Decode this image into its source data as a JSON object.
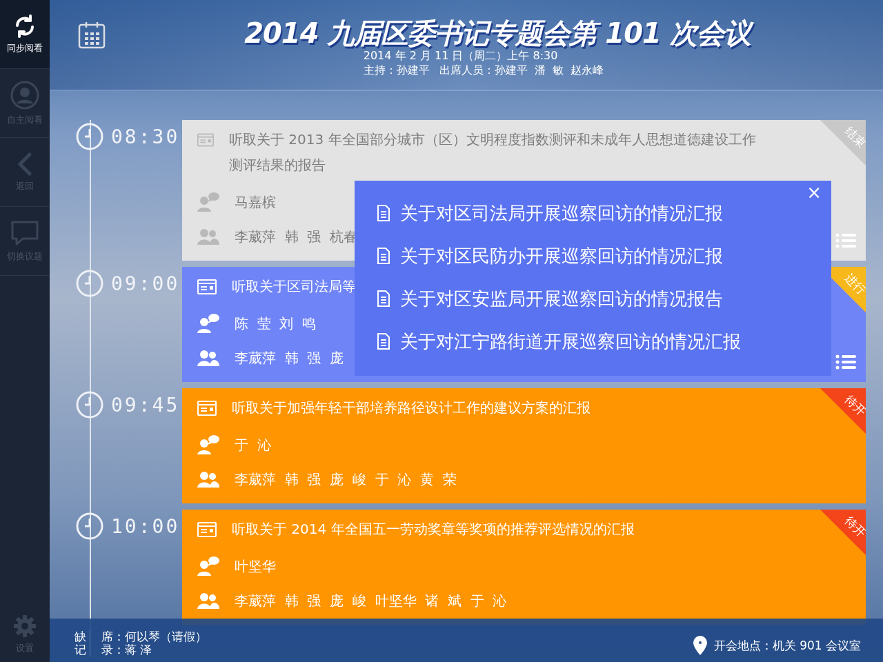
{
  "sidebar": {
    "items": [
      {
        "label": "同步阅看",
        "selected": true
      },
      {
        "label": "自主阅看",
        "selected": false
      },
      {
        "label": "返回",
        "selected": false
      },
      {
        "label": "切换议题",
        "selected": false
      }
    ],
    "settings_label": "设置"
  },
  "header": {
    "title": "2014 九届区委书记专题会第 101 次会议",
    "date": "2014 年 2 月 11 日（周二）上午 8:30",
    "host": "主持：孙建平",
    "attendees": "出席人员：孙建平  潘  敏  赵永峰"
  },
  "agenda": [
    {
      "time": "08:30",
      "kind": "done",
      "status_label": "结束",
      "title": "听取关于 2013 年全国部分城市（区）文明程度指数测评和未成年人思想道德建设工作测评结果的报告",
      "speaker": "马嘉槟",
      "attendees": "李葳萍  韩  强  杭春",
      "has_topics": true
    },
    {
      "time": "09:00",
      "kind": "ongoing",
      "status_label": "进行",
      "title": "听取关于区司法局等",
      "speaker": "陈  莹  刘  鸣",
      "attendees": "李葳萍  韩  强  庞",
      "has_topics": true
    },
    {
      "time": "09:45",
      "kind": "pending",
      "status_label": "待开",
      "title": "听取关于加强年轻干部培养路径设计工作的建议方案的汇报",
      "speaker": "于  沁",
      "attendees": "李葳萍  韩  强  庞  峻  于  沁  黄  荣",
      "has_topics": false
    },
    {
      "time": "10:00",
      "kind": "pending",
      "status_label": "待开",
      "title": "听取关于 2014 年全国五一劳动奖章等奖项的推荐评选情况的汇报",
      "speaker": "叶坚华",
      "attendees": "李葳萍  韩  强  庞  峻  叶坚华  诸  斌  于  沁",
      "has_topics": false
    }
  ],
  "popup": {
    "close": "×",
    "items": [
      "关于对区司法局开展巡察回访的情况汇报",
      "关于对区民防办开展巡察回访的情况汇报",
      "关于对区安监局开展巡察回访的情况报告",
      "关于对江宁路街道开展巡察回访的情况汇报"
    ]
  },
  "footer": {
    "rows": [
      {
        "label": "缺",
        "value": "席：何以琴（请假）"
      },
      {
        "label": "记",
        "value": "录：蒋  泽"
      }
    ],
    "location": "开会地点：机关 901 会议室"
  }
}
